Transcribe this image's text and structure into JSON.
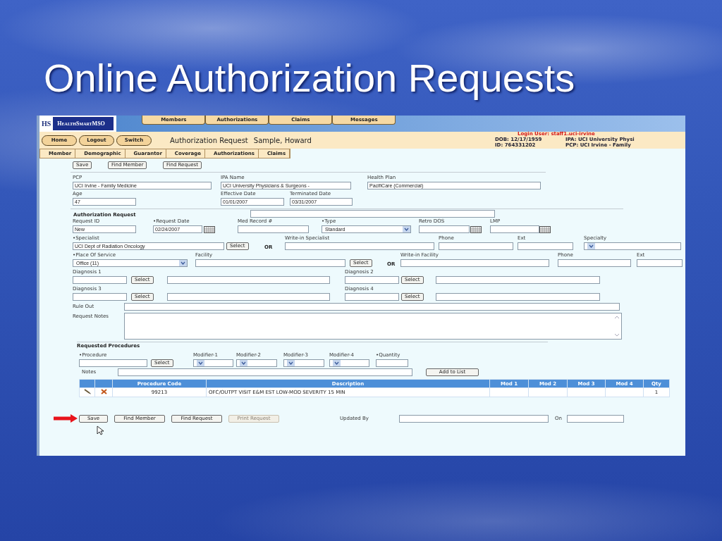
{
  "slide_title": "Online Authorization Requests",
  "app": {
    "logo": {
      "mark": "HS",
      "name": "HealthSmartMSO"
    },
    "top_tabs": [
      {
        "label": "Members",
        "selected": false
      },
      {
        "label": "Authorizations",
        "selected": false
      },
      {
        "label": "Claims",
        "selected": false
      },
      {
        "label": "Messages",
        "selected": false
      }
    ],
    "nav_buttons": [
      "Home",
      "Logout",
      "Switch"
    ],
    "page_title": "Authorization Request",
    "patient_name": "Sample, Howard",
    "member_info": {
      "login_user": "Login User: staff1.uci-irvine",
      "dob": "DOB: 12/17/1959",
      "id": "ID: 764331202",
      "ipa": "IPA: UCI University Physi",
      "pcp": "PCP: UCI Irvine - Family"
    },
    "sub_tabs": [
      {
        "label": "Member",
        "selected": false
      },
      {
        "label": "Demographic",
        "selected": false
      },
      {
        "label": "Guarantor",
        "selected": false
      },
      {
        "label": "Coverage",
        "selected": false
      },
      {
        "label": "Authorizations",
        "selected": false
      },
      {
        "label": "Claims",
        "selected": false
      }
    ],
    "top_buttons": [
      "Save",
      "Find Member",
      "Find Request"
    ],
    "member_fields": {
      "pcp": {
        "label": "PCP",
        "value": "UCI Irvine - Family Medicine"
      },
      "ipa_name": {
        "label": "IPA Name",
        "value": "UCI University Physicians & Surgeons -"
      },
      "health_plan": {
        "label": "Health Plan",
        "value": "PacifiCare (Commercial)"
      },
      "age": {
        "label": "Age",
        "value": "47"
      },
      "effective_date": {
        "label": "Effective Date",
        "value": "01/01/2007"
      },
      "terminated_date": {
        "label": "Terminated Date",
        "value": "03/31/2007"
      }
    },
    "authorization": {
      "heading": "Authorization Request",
      "request_id": {
        "label": "Request ID",
        "value": "New"
      },
      "request_date": {
        "label": "•Request Date",
        "value": "02/24/2007"
      },
      "med_record": {
        "label": "Med Record #"
      },
      "type": {
        "label": "•Type",
        "value": "Standard"
      },
      "retro_dos": {
        "label": "Retro DOS"
      },
      "lmp": {
        "label": "LMP"
      },
      "specialist": {
        "label": "•Specialist",
        "value": "UCI Dept of Radiation Oncology",
        "button": "Select"
      },
      "specialist_or": "OR",
      "write_in_specialist": {
        "label": "Write-in Specialist"
      },
      "specialist_phone": {
        "label": "Phone"
      },
      "specialist_ext": {
        "label": "Ext"
      },
      "specialty": {
        "label": "Specialty"
      },
      "place_of_service": {
        "label": "•Place Of Service",
        "value": "Office (11)"
      },
      "facility": {
        "label": "Facility",
        "button": "Select"
      },
      "facility_or": "OR",
      "write_in_facility": {
        "label": "Write-in Facility"
      },
      "facility_phone": {
        "label": "Phone"
      },
      "facility_ext": {
        "label": "Ext"
      },
      "diagnoses": [
        {
          "label": "Diagnosis 1",
          "button": "Select"
        },
        {
          "label": "Diagnosis 2",
          "button": "Select"
        },
        {
          "label": "Diagnosis 3",
          "button": "Select"
        },
        {
          "label": "Diagnosis 4",
          "button": "Select"
        }
      ],
      "rule_out": {
        "label": "Rule Out"
      },
      "request_notes": {
        "label": "Request Notes"
      }
    },
    "procedures": {
      "heading": "Requested Procedures",
      "procedure": {
        "label": "•Procedure",
        "button": "Select"
      },
      "modifiers": [
        "Modifier-1",
        "Modifier-2",
        "Modifier-3",
        "Modifier-4"
      ],
      "quantity": {
        "label": "•Quantity"
      },
      "notes": {
        "label": "Notes"
      },
      "add_button": "Add to List",
      "table": {
        "columns": [
          "Procedure Code",
          "Description",
          "Mod 1",
          "Mod 2",
          "Mod 3",
          "Mod 4",
          "Qty"
        ],
        "rows": [
          {
            "procedure_code": "99213",
            "description": "OFC/OUTPT VISIT E&M EST LOW-MOD SEVERITY 15 MIN",
            "qty": "1"
          }
        ]
      }
    },
    "bottom_buttons": [
      {
        "label": "Save",
        "disabled": false
      },
      {
        "label": "Find Member",
        "disabled": false
      },
      {
        "label": "Find Request",
        "disabled": false
      },
      {
        "label": "Print Request",
        "disabled": true
      }
    ],
    "updated_by": {
      "label": "Updated By"
    },
    "updated_on": {
      "label": "On"
    }
  }
}
